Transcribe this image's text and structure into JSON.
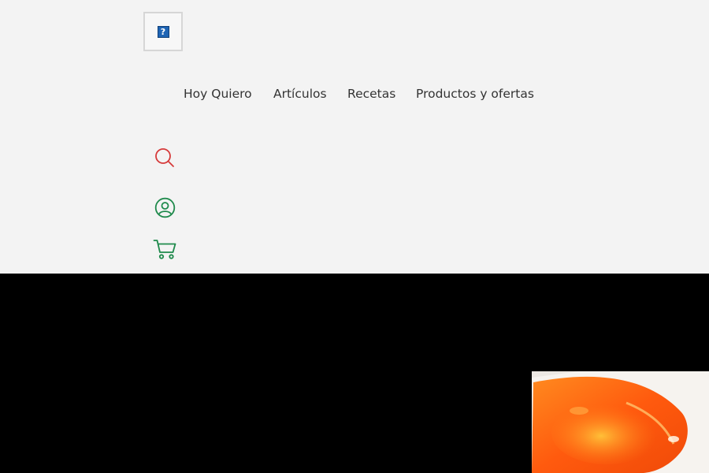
{
  "header": {
    "logo": {
      "icon": "broken-image-icon",
      "glyph": "?"
    },
    "nav": [
      {
        "label": "Hoy Quiero"
      },
      {
        "label": "Artículos"
      },
      {
        "label": "Recetas"
      },
      {
        "label": "Productos y ofertas"
      }
    ],
    "icons": {
      "search": "search-icon",
      "account": "user-circle-icon",
      "cart": "cart-icon"
    },
    "colors": {
      "background": "#f3f3f3",
      "nav_text": "#333333",
      "search_icon": "#d63a3a",
      "account_icon": "#1f8a4c",
      "cart_icon": "#1f8a4c"
    }
  },
  "hero": {
    "background": "#000000",
    "image": {
      "icon": "orange-jelly-photo"
    }
  }
}
